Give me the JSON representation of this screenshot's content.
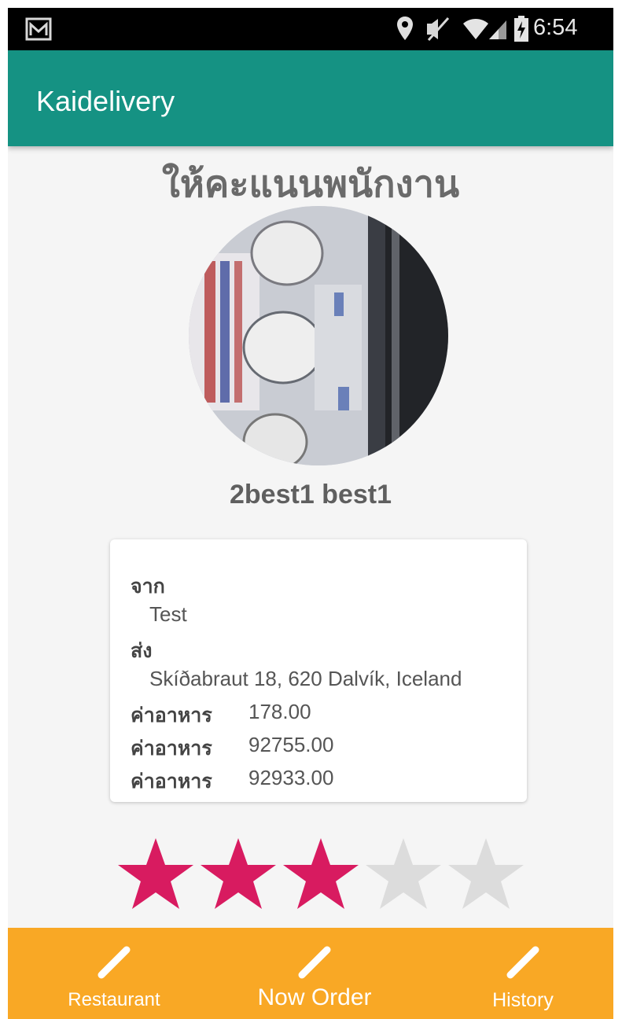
{
  "status_bar": {
    "time": "6:54",
    "icons": [
      "mail-icon",
      "location-pin-icon",
      "mute-icon",
      "wifi-icon",
      "signal-icon",
      "battery-charging-icon"
    ]
  },
  "app_bar": {
    "title": "Kaidelivery"
  },
  "page": {
    "title": "ให้คะแนนพนักงาน",
    "staff_name": "2best1 best1"
  },
  "order": {
    "from_label": "จาก",
    "from_value": "Test",
    "to_label": "ส่ง",
    "to_value": "Skíðabraut 18, 620 Dalvík, Iceland",
    "fees": [
      {
        "label": "ค่าอาหาร",
        "value": "178.00"
      },
      {
        "label": "ค่าอาหาร",
        "value": "92755.00"
      },
      {
        "label": "ค่าอาหาร",
        "value": "92933.00"
      }
    ]
  },
  "rating": {
    "value": 3,
    "max": 5,
    "active_color": "#d81b60",
    "inactive_color": "#dcdcdc"
  },
  "bottom_nav": {
    "items": [
      {
        "label": "Restaurant",
        "icon": "pencil-icon"
      },
      {
        "label": "Now Order",
        "icon": "pencil-icon"
      },
      {
        "label": "History",
        "icon": "pencil-icon"
      }
    ]
  },
  "colors": {
    "app_bar": "#159283",
    "bottom_nav": "#f9a825"
  }
}
